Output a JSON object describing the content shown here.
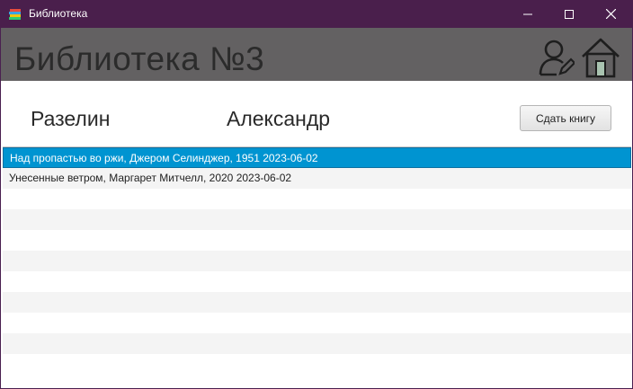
{
  "window": {
    "title": "Библиотека"
  },
  "header": {
    "title": "Библиотека №3",
    "icons": [
      "user-edit-icon",
      "home-icon"
    ]
  },
  "reader": {
    "last_name": "Разелин",
    "first_name": "Александр"
  },
  "actions": {
    "return_book_label": "Сдать книгу"
  },
  "books": {
    "selected_index": 0,
    "items": [
      "Над пропастью во ржи, Джером Селинджер, 1951 2023-06-02",
      "Унесенные ветром, Маргарет Митчелл, 2020 2023-06-02"
    ],
    "empty_rows": 9
  },
  "colors": {
    "titlebar": "#4a1f4c",
    "header": "#636162",
    "selection": "#0094d1"
  }
}
